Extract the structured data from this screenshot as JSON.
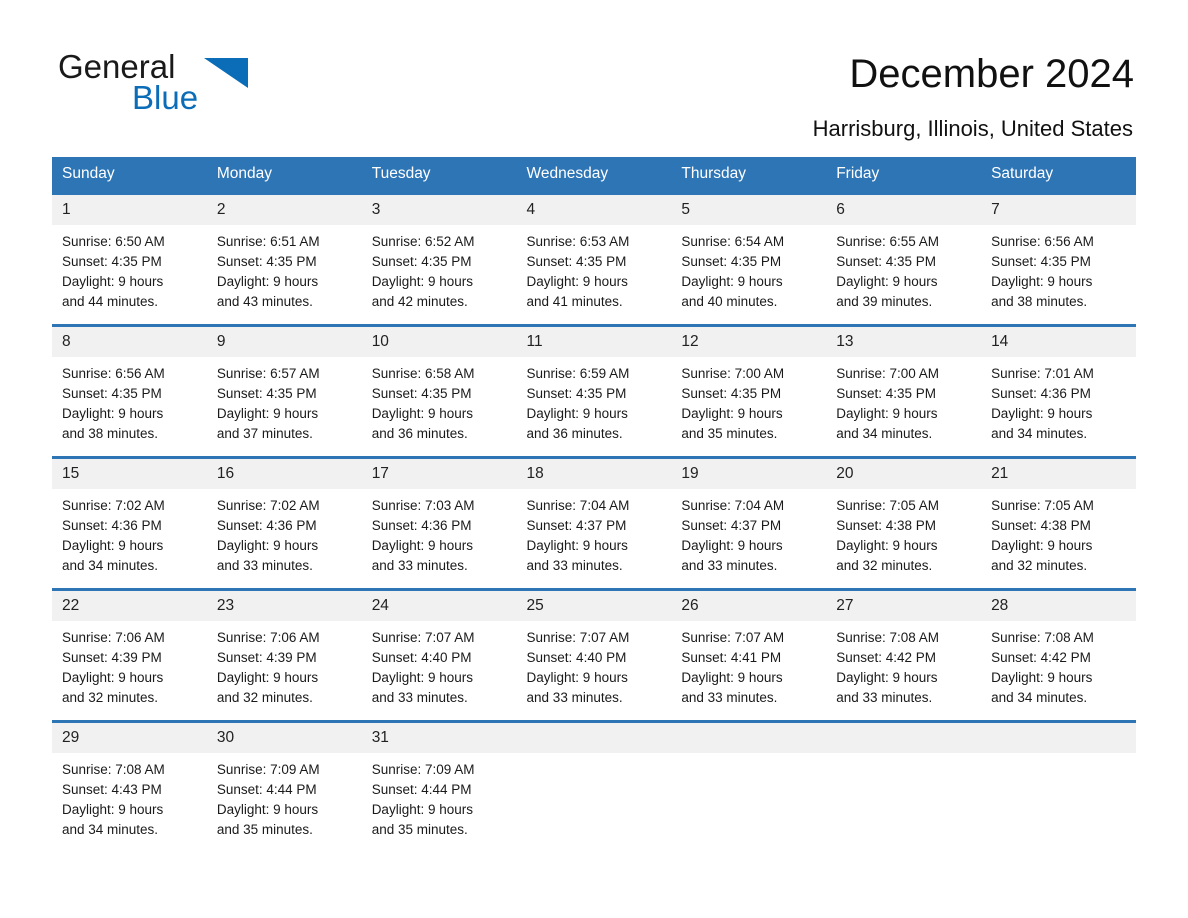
{
  "brand": {
    "name_part1": "General",
    "name_part2": "Blue",
    "triangle_color": "#0b6cb7",
    "text_color": "#1a1a1a"
  },
  "header": {
    "title": "December 2024",
    "location": "Harrisburg, Illinois, United States"
  },
  "theme": {
    "header_bg": "#2e75b6",
    "header_text": "#ffffff",
    "daynum_bg": "#f1f1f1",
    "row_border": "#2e75b6",
    "page_bg": "#ffffff"
  },
  "weekdays": [
    "Sunday",
    "Monday",
    "Tuesday",
    "Wednesday",
    "Thursday",
    "Friday",
    "Saturday"
  ],
  "labels": {
    "sunrise_prefix": "Sunrise:",
    "sunset_prefix": "Sunset:",
    "daylight_prefix": "Daylight:"
  },
  "weeks": [
    [
      {
        "day": "1",
        "sunrise": "Sunrise: 6:50 AM",
        "sunset": "Sunset: 4:35 PM",
        "daylight_line1": "Daylight: 9 hours",
        "daylight_line2": "and 44 minutes."
      },
      {
        "day": "2",
        "sunrise": "Sunrise: 6:51 AM",
        "sunset": "Sunset: 4:35 PM",
        "daylight_line1": "Daylight: 9 hours",
        "daylight_line2": "and 43 minutes."
      },
      {
        "day": "3",
        "sunrise": "Sunrise: 6:52 AM",
        "sunset": "Sunset: 4:35 PM",
        "daylight_line1": "Daylight: 9 hours",
        "daylight_line2": "and 42 minutes."
      },
      {
        "day": "4",
        "sunrise": "Sunrise: 6:53 AM",
        "sunset": "Sunset: 4:35 PM",
        "daylight_line1": "Daylight: 9 hours",
        "daylight_line2": "and 41 minutes."
      },
      {
        "day": "5",
        "sunrise": "Sunrise: 6:54 AM",
        "sunset": "Sunset: 4:35 PM",
        "daylight_line1": "Daylight: 9 hours",
        "daylight_line2": "and 40 minutes."
      },
      {
        "day": "6",
        "sunrise": "Sunrise: 6:55 AM",
        "sunset": "Sunset: 4:35 PM",
        "daylight_line1": "Daylight: 9 hours",
        "daylight_line2": "and 39 minutes."
      },
      {
        "day": "7",
        "sunrise": "Sunrise: 6:56 AM",
        "sunset": "Sunset: 4:35 PM",
        "daylight_line1": "Daylight: 9 hours",
        "daylight_line2": "and 38 minutes."
      }
    ],
    [
      {
        "day": "8",
        "sunrise": "Sunrise: 6:56 AM",
        "sunset": "Sunset: 4:35 PM",
        "daylight_line1": "Daylight: 9 hours",
        "daylight_line2": "and 38 minutes."
      },
      {
        "day": "9",
        "sunrise": "Sunrise: 6:57 AM",
        "sunset": "Sunset: 4:35 PM",
        "daylight_line1": "Daylight: 9 hours",
        "daylight_line2": "and 37 minutes."
      },
      {
        "day": "10",
        "sunrise": "Sunrise: 6:58 AM",
        "sunset": "Sunset: 4:35 PM",
        "daylight_line1": "Daylight: 9 hours",
        "daylight_line2": "and 36 minutes."
      },
      {
        "day": "11",
        "sunrise": "Sunrise: 6:59 AM",
        "sunset": "Sunset: 4:35 PM",
        "daylight_line1": "Daylight: 9 hours",
        "daylight_line2": "and 36 minutes."
      },
      {
        "day": "12",
        "sunrise": "Sunrise: 7:00 AM",
        "sunset": "Sunset: 4:35 PM",
        "daylight_line1": "Daylight: 9 hours",
        "daylight_line2": "and 35 minutes."
      },
      {
        "day": "13",
        "sunrise": "Sunrise: 7:00 AM",
        "sunset": "Sunset: 4:35 PM",
        "daylight_line1": "Daylight: 9 hours",
        "daylight_line2": "and 34 minutes."
      },
      {
        "day": "14",
        "sunrise": "Sunrise: 7:01 AM",
        "sunset": "Sunset: 4:36 PM",
        "daylight_line1": "Daylight: 9 hours",
        "daylight_line2": "and 34 minutes."
      }
    ],
    [
      {
        "day": "15",
        "sunrise": "Sunrise: 7:02 AM",
        "sunset": "Sunset: 4:36 PM",
        "daylight_line1": "Daylight: 9 hours",
        "daylight_line2": "and 34 minutes."
      },
      {
        "day": "16",
        "sunrise": "Sunrise: 7:02 AM",
        "sunset": "Sunset: 4:36 PM",
        "daylight_line1": "Daylight: 9 hours",
        "daylight_line2": "and 33 minutes."
      },
      {
        "day": "17",
        "sunrise": "Sunrise: 7:03 AM",
        "sunset": "Sunset: 4:36 PM",
        "daylight_line1": "Daylight: 9 hours",
        "daylight_line2": "and 33 minutes."
      },
      {
        "day": "18",
        "sunrise": "Sunrise: 7:04 AM",
        "sunset": "Sunset: 4:37 PM",
        "daylight_line1": "Daylight: 9 hours",
        "daylight_line2": "and 33 minutes."
      },
      {
        "day": "19",
        "sunrise": "Sunrise: 7:04 AM",
        "sunset": "Sunset: 4:37 PM",
        "daylight_line1": "Daylight: 9 hours",
        "daylight_line2": "and 33 minutes."
      },
      {
        "day": "20",
        "sunrise": "Sunrise: 7:05 AM",
        "sunset": "Sunset: 4:38 PM",
        "daylight_line1": "Daylight: 9 hours",
        "daylight_line2": "and 32 minutes."
      },
      {
        "day": "21",
        "sunrise": "Sunrise: 7:05 AM",
        "sunset": "Sunset: 4:38 PM",
        "daylight_line1": "Daylight: 9 hours",
        "daylight_line2": "and 32 minutes."
      }
    ],
    [
      {
        "day": "22",
        "sunrise": "Sunrise: 7:06 AM",
        "sunset": "Sunset: 4:39 PM",
        "daylight_line1": "Daylight: 9 hours",
        "daylight_line2": "and 32 minutes."
      },
      {
        "day": "23",
        "sunrise": "Sunrise: 7:06 AM",
        "sunset": "Sunset: 4:39 PM",
        "daylight_line1": "Daylight: 9 hours",
        "daylight_line2": "and 32 minutes."
      },
      {
        "day": "24",
        "sunrise": "Sunrise: 7:07 AM",
        "sunset": "Sunset: 4:40 PM",
        "daylight_line1": "Daylight: 9 hours",
        "daylight_line2": "and 33 minutes."
      },
      {
        "day": "25",
        "sunrise": "Sunrise: 7:07 AM",
        "sunset": "Sunset: 4:40 PM",
        "daylight_line1": "Daylight: 9 hours",
        "daylight_line2": "and 33 minutes."
      },
      {
        "day": "26",
        "sunrise": "Sunrise: 7:07 AM",
        "sunset": "Sunset: 4:41 PM",
        "daylight_line1": "Daylight: 9 hours",
        "daylight_line2": "and 33 minutes."
      },
      {
        "day": "27",
        "sunrise": "Sunrise: 7:08 AM",
        "sunset": "Sunset: 4:42 PM",
        "daylight_line1": "Daylight: 9 hours",
        "daylight_line2": "and 33 minutes."
      },
      {
        "day": "28",
        "sunrise": "Sunrise: 7:08 AM",
        "sunset": "Sunset: 4:42 PM",
        "daylight_line1": "Daylight: 9 hours",
        "daylight_line2": "and 34 minutes."
      }
    ],
    [
      {
        "day": "29",
        "sunrise": "Sunrise: 7:08 AM",
        "sunset": "Sunset: 4:43 PM",
        "daylight_line1": "Daylight: 9 hours",
        "daylight_line2": "and 34 minutes."
      },
      {
        "day": "30",
        "sunrise": "Sunrise: 7:09 AM",
        "sunset": "Sunset: 4:44 PM",
        "daylight_line1": "Daylight: 9 hours",
        "daylight_line2": "and 35 minutes."
      },
      {
        "day": "31",
        "sunrise": "Sunrise: 7:09 AM",
        "sunset": "Sunset: 4:44 PM",
        "daylight_line1": "Daylight: 9 hours",
        "daylight_line2": "and 35 minutes."
      },
      {
        "day": "",
        "sunrise": "",
        "sunset": "",
        "daylight_line1": "",
        "daylight_line2": ""
      },
      {
        "day": "",
        "sunrise": "",
        "sunset": "",
        "daylight_line1": "",
        "daylight_line2": ""
      },
      {
        "day": "",
        "sunrise": "",
        "sunset": "",
        "daylight_line1": "",
        "daylight_line2": ""
      },
      {
        "day": "",
        "sunrise": "",
        "sunset": "",
        "daylight_line1": "",
        "daylight_line2": ""
      }
    ]
  ]
}
